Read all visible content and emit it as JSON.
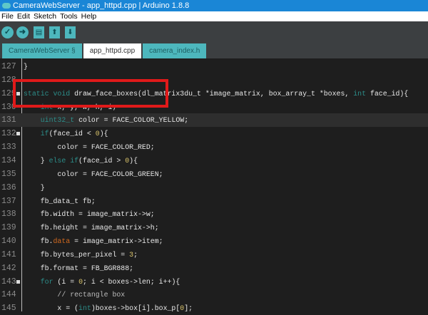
{
  "window": {
    "title": "CameraWebServer - app_httpd.cpp | Arduino 1.8.8"
  },
  "menu": [
    "File",
    "Edit",
    "Sketch",
    "Tools",
    "Help"
  ],
  "toolbar": {
    "verify": "✓",
    "upload": "➜",
    "new": "▤",
    "open": "⬆",
    "save": "⬇"
  },
  "tabs": [
    "CameraWebServer §",
    "app_httpd.cpp",
    "camera_index.h"
  ],
  "active_tab": 1,
  "highlight_color": "#e01a1a",
  "code": [
    {
      "n": "127",
      "s": [
        [
          "}",
          ""
        ]
      ]
    },
    {
      "n": "128",
      "s": []
    },
    {
      "n": "129",
      "fold": true,
      "s": [
        [
          "static void",
          "k"
        ],
        [
          " draw_face_boxes(dl_matrix3du_t *image_matrix, box_array_t *boxes, ",
          ""
        ],
        [
          "int",
          "k"
        ],
        [
          " face_id){",
          ""
        ]
      ]
    },
    {
      "n": "130",
      "s": [
        [
          "    ",
          ""
        ],
        [
          "int",
          "k"
        ],
        [
          " x, y, w, h, i;",
          ""
        ]
      ]
    },
    {
      "n": "131",
      "hl": true,
      "s": [
        [
          "    ",
          ""
        ],
        [
          "uint32_t",
          "t"
        ],
        [
          " color = FACE_COLOR_YELLOW;",
          ""
        ]
      ]
    },
    {
      "n": "132",
      "fold": true,
      "s": [
        [
          "    ",
          ""
        ],
        [
          "if",
          "k"
        ],
        [
          "(face_id < ",
          ""
        ],
        [
          "0",
          "n"
        ],
        [
          "){",
          ""
        ]
      ]
    },
    {
      "n": "133",
      "s": [
        [
          "        color = FACE_COLOR_RED;",
          ""
        ]
      ]
    },
    {
      "n": "134",
      "s": [
        [
          "    } ",
          ""
        ],
        [
          "else if",
          "k"
        ],
        [
          "(face_id > ",
          ""
        ],
        [
          "0",
          "n"
        ],
        [
          "){",
          ""
        ]
      ]
    },
    {
      "n": "135",
      "s": [
        [
          "        color = FACE_COLOR_GREEN;",
          ""
        ]
      ]
    },
    {
      "n": "136",
      "s": [
        [
          "    }",
          ""
        ]
      ]
    },
    {
      "n": "137",
      "s": [
        [
          "    fb_data_t fb;",
          ""
        ]
      ]
    },
    {
      "n": "138",
      "s": [
        [
          "    fb.width = image_matrix->w;",
          ""
        ]
      ]
    },
    {
      "n": "139",
      "s": [
        [
          "    fb.height = image_matrix->h;",
          ""
        ]
      ]
    },
    {
      "n": "140",
      "s": [
        [
          "    fb.",
          ""
        ],
        [
          "data",
          "o"
        ],
        [
          " = image_matrix->item;",
          ""
        ]
      ]
    },
    {
      "n": "141",
      "s": [
        [
          "    fb.bytes_per_pixel = ",
          ""
        ],
        [
          "3",
          "n"
        ],
        [
          ";",
          ""
        ]
      ]
    },
    {
      "n": "142",
      "s": [
        [
          "    fb.format = FB_BGR888;",
          ""
        ]
      ]
    },
    {
      "n": "143",
      "fold": true,
      "s": [
        [
          "    ",
          ""
        ],
        [
          "for",
          "k"
        ],
        [
          " (i = ",
          ""
        ],
        [
          "0",
          "n"
        ],
        [
          "; i < boxes->len; i++){",
          ""
        ]
      ]
    },
    {
      "n": "144",
      "s": [
        [
          "        ",
          ""
        ],
        [
          "// rectangle box",
          "c"
        ]
      ]
    },
    {
      "n": "145",
      "s": [
        [
          "        x = (",
          ""
        ],
        [
          "int",
          "k"
        ],
        [
          ")boxes->box[i].box_p[",
          ""
        ],
        [
          "0",
          "n"
        ],
        [
          "];",
          ""
        ]
      ]
    }
  ]
}
